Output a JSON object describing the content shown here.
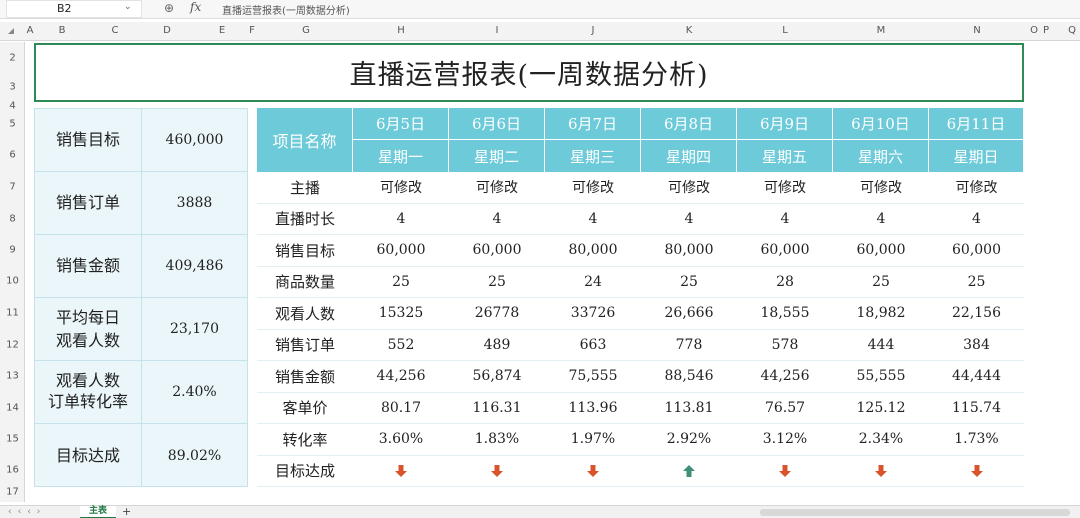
{
  "formula_bar": {
    "cell_ref": "B2",
    "fx": "fx",
    "content": "直播运营报表(一周数据分析)"
  },
  "columns": [
    "A",
    "B",
    "C",
    "D",
    "E",
    "F",
    "G",
    "H",
    "I",
    "J",
    "K",
    "L",
    "M",
    "N",
    "O",
    "P",
    "Q"
  ],
  "rows": [
    "2",
    "3",
    "4",
    "5",
    "6",
    "7",
    "8",
    "9",
    "10",
    "11",
    "12",
    "13",
    "14",
    "15",
    "16",
    "17"
  ],
  "title": "直播运营报表(一周数据分析)",
  "summary": [
    {
      "label": "销售目标",
      "value": "460,000"
    },
    {
      "label": "销售订单",
      "value": "3888"
    },
    {
      "label": "销售金额",
      "value": "409,486"
    },
    {
      "label_lines": [
        "平均每日",
        "观看人数"
      ],
      "value": "23,170"
    },
    {
      "label_lines": [
        "观看人数",
        "订单转化率"
      ],
      "value": "2.40%"
    },
    {
      "label": "目标达成",
      "value": "89.02%"
    }
  ],
  "table": {
    "name_header": "项目名称",
    "dates": [
      "6月5日",
      "6月6日",
      "6月7日",
      "6月8日",
      "6月9日",
      "6月10日",
      "6月11日"
    ],
    "days": [
      "星期一",
      "星期二",
      "星期三",
      "星期四",
      "星期五",
      "星期六",
      "星期日"
    ],
    "rows": [
      {
        "label": "主播",
        "values": [
          "可修改",
          "可修改",
          "可修改",
          "可修改",
          "可修改",
          "可修改",
          "可修改"
        ]
      },
      {
        "label": "直播时长",
        "values": [
          "4",
          "4",
          "4",
          "4",
          "4",
          "4",
          "4"
        ]
      },
      {
        "label": "销售目标",
        "values": [
          "60,000",
          "60,000",
          "80,000",
          "80,000",
          "60,000",
          "60,000",
          "60,000"
        ]
      },
      {
        "label": "商品数量",
        "values": [
          "25",
          "25",
          "24",
          "25",
          "28",
          "25",
          "25"
        ]
      },
      {
        "label": "观看人数",
        "values": [
          "15325",
          "26778",
          "33726",
          "26,666",
          "18,555",
          "18,982",
          "22,156"
        ]
      },
      {
        "label": "销售订单",
        "values": [
          "552",
          "489",
          "663",
          "778",
          "578",
          "444",
          "384"
        ]
      },
      {
        "label": "销售金额",
        "values": [
          "44,256",
          "56,874",
          "75,555",
          "88,546",
          "44,256",
          "55,555",
          "44,444"
        ]
      },
      {
        "label": "客单价",
        "values": [
          "80.17",
          "116.31",
          "113.96",
          "113.81",
          "76.57",
          "125.12",
          "115.74"
        ]
      },
      {
        "label": "转化率",
        "values": [
          "3.60%",
          "1.83%",
          "1.97%",
          "2.92%",
          "3.12%",
          "2.34%",
          "1.73%"
        ]
      },
      {
        "label": "目标达成",
        "arrows": [
          "down",
          "down",
          "down",
          "up",
          "down",
          "down",
          "down"
        ]
      }
    ]
  },
  "colors": {
    "header_bg": "#6dcad9",
    "summary_bg": "#eaf6f9",
    "title_border": "#2e8b57",
    "arrow_down": "#d9532c",
    "arrow_up": "#3f8f7a"
  },
  "sheet": {
    "active_tab": "主表",
    "add": "+"
  }
}
